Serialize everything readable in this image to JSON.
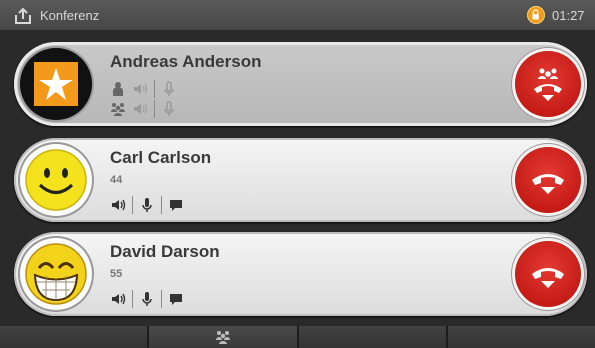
{
  "topbar": {
    "title": "Konferenz",
    "time": "01:27"
  },
  "calls": [
    {
      "name": "Andreas Anderson",
      "number": ""
    },
    {
      "name": "Carl Carlson",
      "number": "44"
    },
    {
      "name": "David Darson",
      "number": "55"
    }
  ],
  "colors": {
    "hangup": "#c4120d",
    "lock": "#f29a1b"
  },
  "icons": [
    "share-icon",
    "lock-icon",
    "person-icon",
    "group-icon",
    "speaker-icon",
    "microphone-icon",
    "chat-icon",
    "hangup-icon",
    "conference-hangup-icon",
    "star-icon",
    "smiley-icon",
    "grin-icon"
  ]
}
